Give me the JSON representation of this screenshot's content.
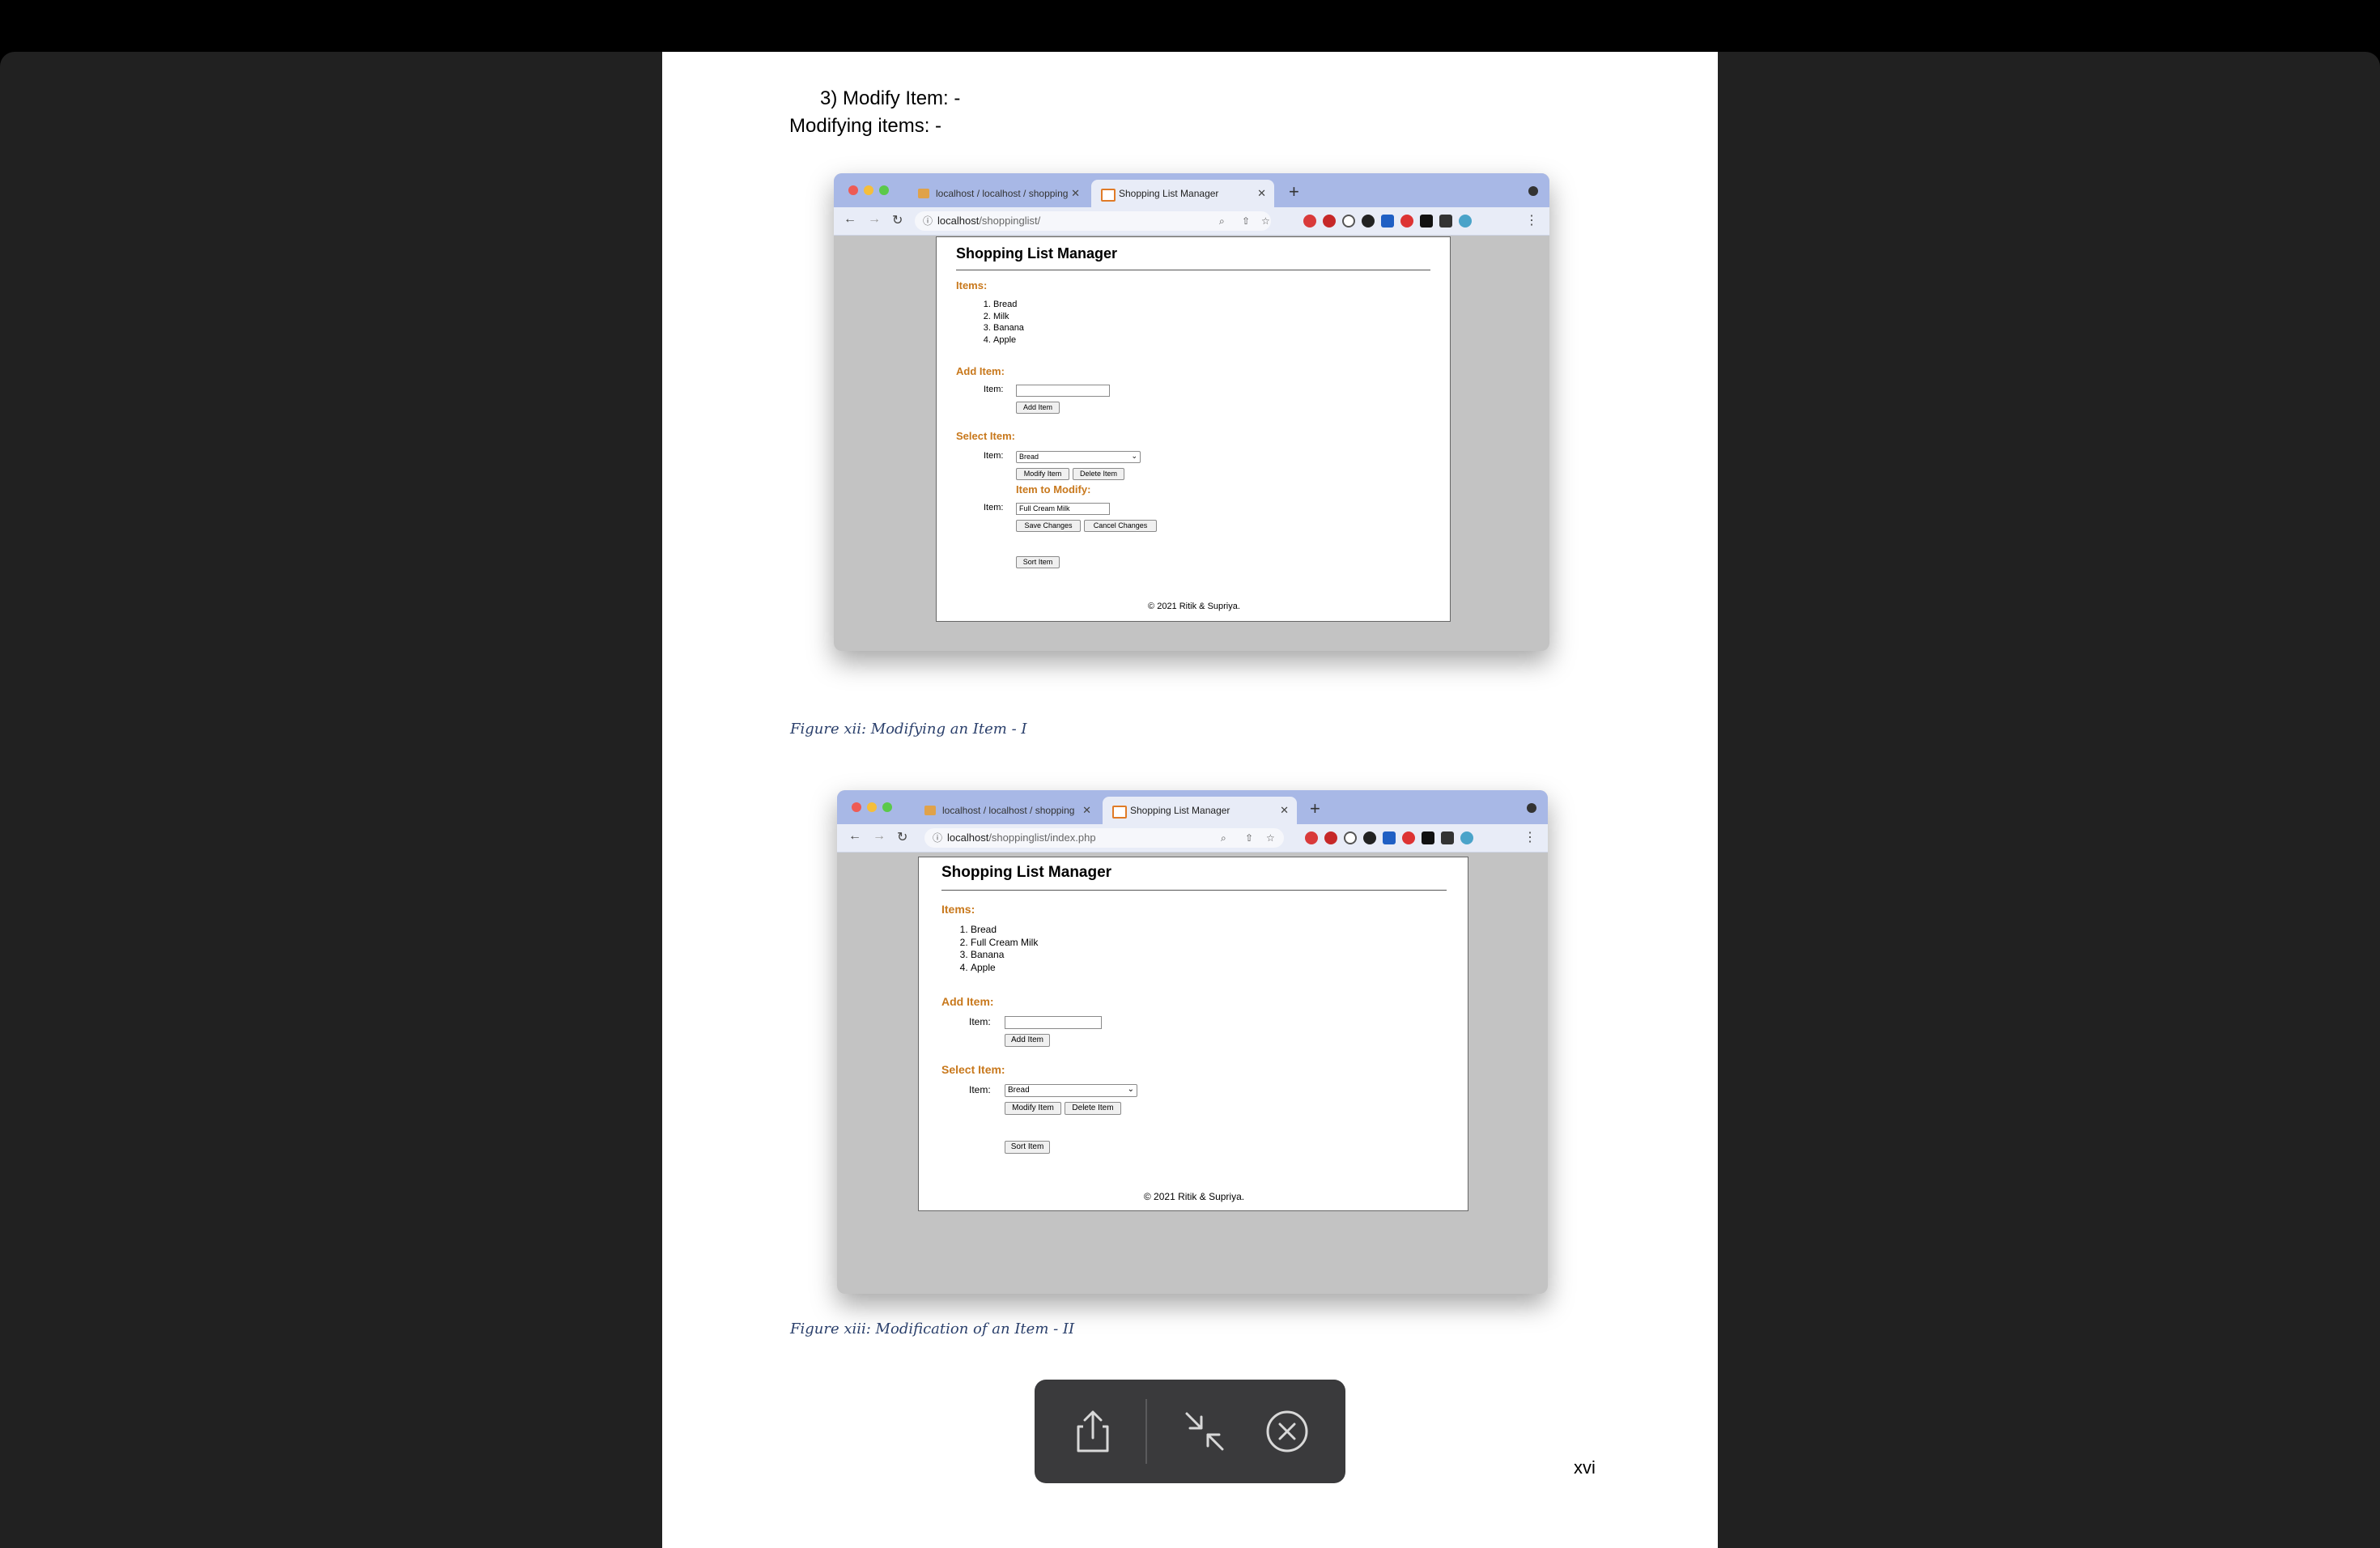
{
  "document": {
    "heading1": "3) Modify Item: -",
    "heading2": "Modifying items: -",
    "caption1": "Figure xii: Modifying an Item - I",
    "caption2": "Figure xiii: Modification of an Item - II",
    "page_number": "xvi"
  },
  "browser1": {
    "tab1": "localhost / localhost / shopping",
    "tab2": "Shopping List Manager",
    "url_host": "localhost",
    "url_path": "/shoppinglist/",
    "page": {
      "title": "Shopping List Manager",
      "items_heading": "Items:",
      "items": [
        "Bread",
        "Milk",
        "Banana",
        "Apple"
      ],
      "add_heading": "Add Item:",
      "item_label": "Item:",
      "add_value": "",
      "add_button": "Add Item",
      "select_heading": "Select Item:",
      "select_value": "Bread",
      "modify_button": "Modify Item",
      "delete_button": "Delete Item",
      "modify_heading": "Item to Modify:",
      "modify_value": "Full Cream Milk",
      "save_button": "Save Changes",
      "cancel_button": "Cancel Changes",
      "sort_button": "Sort Item",
      "footer": "© 2021 Ritik & Supriya."
    }
  },
  "browser2": {
    "tab1": "localhost / localhost / shopping",
    "tab2": "Shopping List Manager",
    "url_host": "localhost",
    "url_path": "/shoppinglist/index.php",
    "page": {
      "title": "Shopping List Manager",
      "items_heading": "Items:",
      "items": [
        "Bread",
        "Full Cream Milk",
        "Banana",
        "Apple"
      ],
      "add_heading": "Add Item:",
      "item_label": "Item:",
      "add_value": "",
      "add_button": "Add Item",
      "select_heading": "Select Item:",
      "select_value": "Bread",
      "modify_button": "Modify Item",
      "delete_button": "Delete Item",
      "sort_button": "Sort Item",
      "footer": "© 2021 Ritik & Supriya."
    }
  },
  "icons": {
    "share": "share-icon",
    "collapse": "collapse-icon",
    "close": "close-circle-icon"
  },
  "colors": {
    "section_heading": "#c8781c",
    "tabbar": "#a8b8e6",
    "viewer_bg": "#212121",
    "toolbar_bg": "#3a3a3c"
  }
}
